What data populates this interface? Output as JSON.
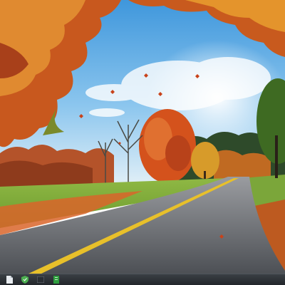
{
  "desktop": {
    "wallpaper": "autumn-road-landscape"
  },
  "taskbar": {
    "items": [
      {
        "icon": "document-icon"
      },
      {
        "icon": "shield-icon",
        "color": "#4caf50"
      },
      {
        "icon": "window-icon"
      },
      {
        "icon": "green-app-icon",
        "color": "#2e9e3e"
      }
    ]
  },
  "colors": {
    "sky": "#6fb3e6",
    "foliage": "#c8501e",
    "road": "#5a5d62",
    "grass": "#7caa3c",
    "taskbar": "#2b2f33"
  }
}
